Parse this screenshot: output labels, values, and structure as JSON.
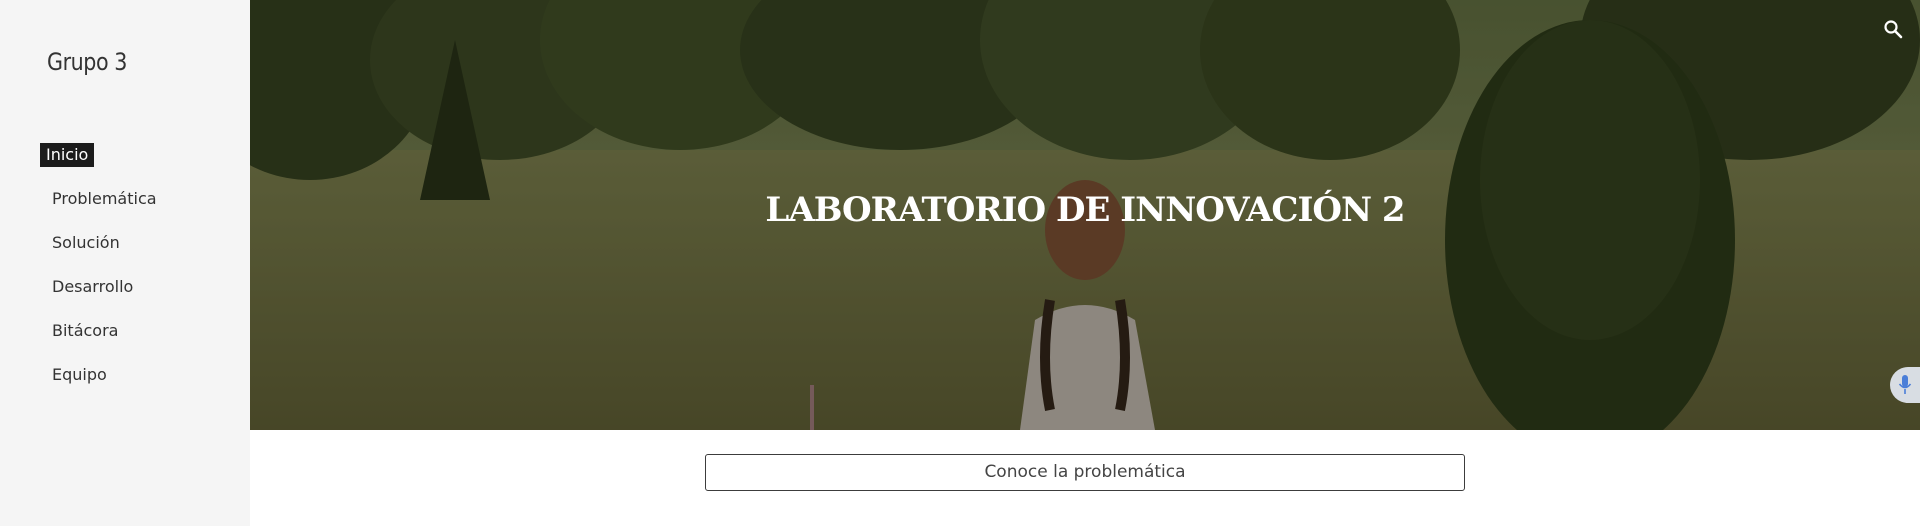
{
  "sidebar": {
    "site_title": "Grupo 3",
    "nav_items": [
      {
        "label": "Inicio",
        "active": true
      },
      {
        "label": "Problemática",
        "active": false
      },
      {
        "label": "Solución",
        "active": false
      },
      {
        "label": "Desarrollo",
        "active": false
      },
      {
        "label": "Bitácora",
        "active": false
      },
      {
        "label": "Equipo",
        "active": false
      }
    ]
  },
  "hero": {
    "title": "LABORATORIO DE INNOVACIÓN 2"
  },
  "toolbar": {
    "search_icon": "search-icon",
    "mic_icon": "microphone-icon"
  },
  "cta": {
    "label": "Conoce la problemática"
  },
  "colors": {
    "sidebar_bg": "#f5f5f5",
    "active_nav_bg": "#1c1c1c",
    "text": "#333333"
  }
}
